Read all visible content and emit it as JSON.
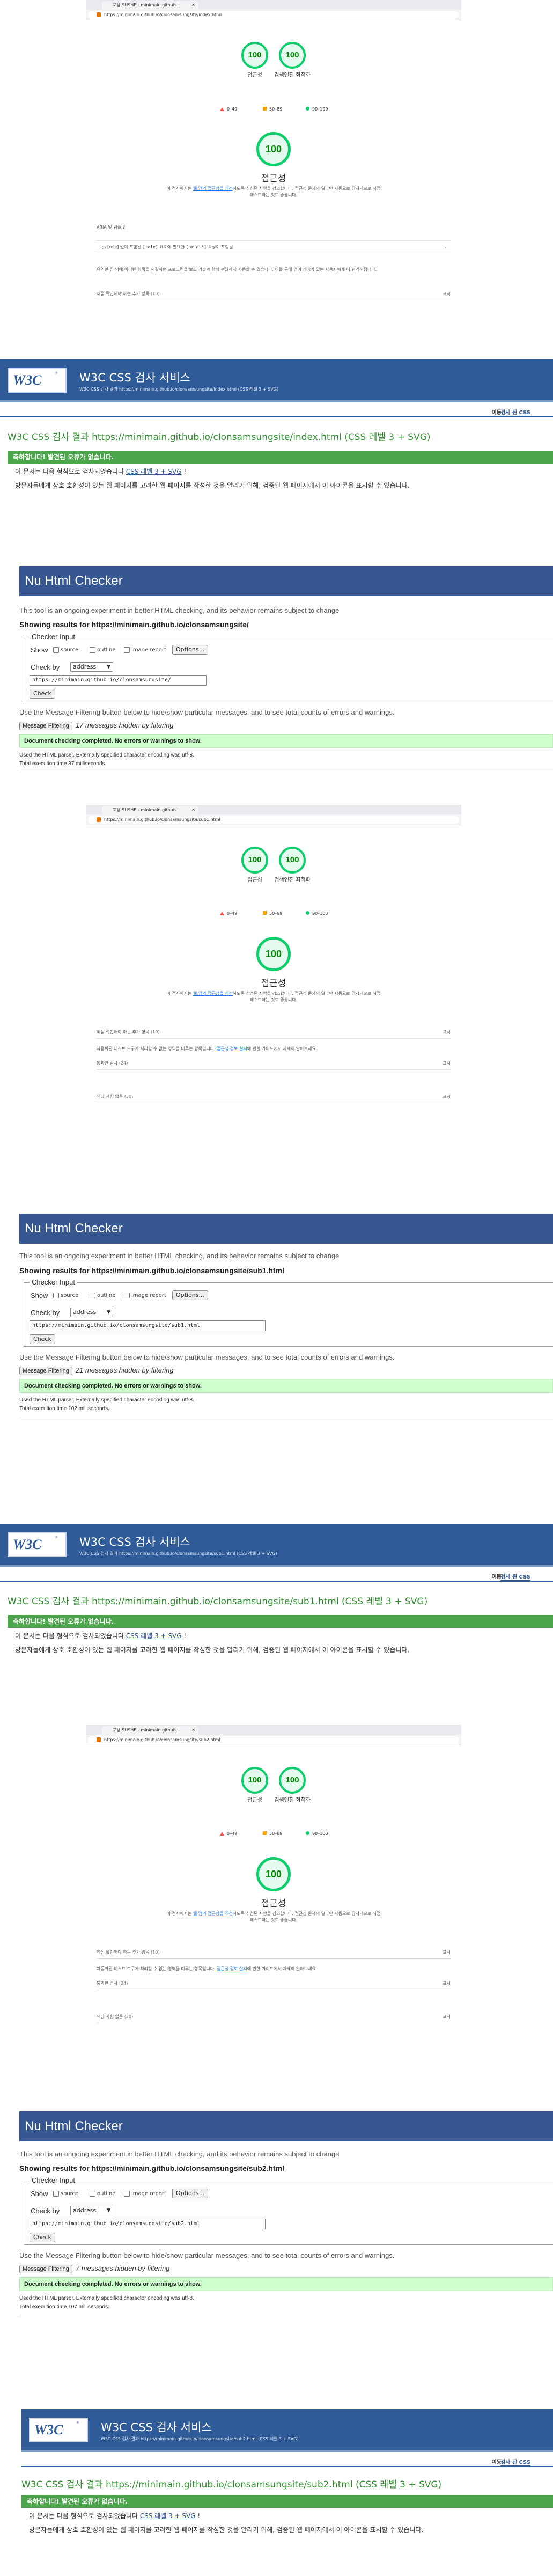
{
  "lh1": {
    "tab_title": "포용 SUSHE - minimain.github.i",
    "url": "https://minimain.github.io/clonsamsungsite/index.html",
    "gauges": [
      {
        "value": "100",
        "label": "접근성"
      },
      {
        "value": "100",
        "label": "검색엔진 최적화"
      }
    ],
    "legend": [
      "0–49",
      "50–89",
      "90–100"
    ],
    "big_value": "100",
    "big_title": "접근성",
    "desc_pre": "이 검사에서는 ",
    "desc_link": "웹 앱의 접근성을 개선",
    "desc_post": "하도록 추천된 사항을 강조합니다. 접근성 문제의 일부만 자동으로 감지되므로 직접 테스트하는 것도 좋습니다.",
    "section_label": "ARIA 및 템플릿",
    "aria_item_pre": "[role] 값이 포함된 ",
    "aria_item_code": "[role]",
    "aria_item_mid": " 요소에 필요한 ",
    "aria_item_code2": "[aria-*]",
    "aria_item_post": " 속성이 포함됨",
    "para": "유익한 팁 외에 이러한 항목을 해결하면 프로그램을 보조 기술과 함께 수월하게 사용할 수 있습니다. 이를 통해 앱이 장애가 있는 사용자에게 더 편리해집니다.",
    "row1_label": "직접 확인해야 하는 추가 항목",
    "row1_count": "(10)",
    "row1_right": "표시"
  },
  "w3_1": {
    "title": "W3C CSS 검사 서비스",
    "sub": "W3C CSS 검사 결과 https://minimain.github.io/clonsamsungsite/index.html (CSS 레벨 3 + SVG)",
    "bar_label": "이동:",
    "bar_link": "검사 된 CSS",
    "result": "W3C CSS 검사 결과 https://minimain.github.io/clonsamsungsite/index.html (CSS 레벨 3 + SVG)",
    "ok": "축하합니다! 발견된 오류가 없습니다.",
    "line1_pre": "이 문서는 다음 형식으로 검사되었습니다 ",
    "line1_link": "CSS 레벨 3 + SVG",
    "line1_post": " !",
    "line2": "방문자들에게 상호 호환성이 있는 웹 페이지를 고려한 웹 페이지를 작성한 것을 알리기 위해, 검증된 웹 페이지에서 이 아이콘을 표시할 수 있습니다."
  },
  "nu1": {
    "title": "Nu Html Checker",
    "experiment": "This tool is an ongoing experiment in better HTML checking, and its behavior remains subject to change",
    "showing": "Showing results for https://minimain.github.io/clonsamsungsite/",
    "input_legend": "Checker Input",
    "show_label": "Show",
    "cb_source": "source",
    "cb_outline": "outline",
    "cb_image": "image report",
    "options_btn": "Options...",
    "checkby_label": "Check by",
    "checkby_value": "address",
    "url_value": "https://minimain.github.io/clonsamsungsite/",
    "check_btn": "Check",
    "filter_hint": "Use the Message Filtering button below to hide/show particular messages, and to see total counts of errors and warnings.",
    "filter_btn": "Message Filtering",
    "hidden": "17 messages hidden by filtering",
    "completed": "Document checking completed. No errors or warnings to show.",
    "parser": "Used the HTML parser. Externally specified character encoding was utf-8.",
    "time": "Total execution time 87 milliseconds."
  },
  "lh2": {
    "tab_title": "포용 SUSHE - minimain.github.i",
    "url": "https://minimain.github.io/clonsamsungsite/sub1.html",
    "gauges": [
      {
        "value": "100",
        "label": "접근성"
      },
      {
        "value": "100",
        "label": "검색엔진 최적화"
      }
    ],
    "legend": [
      "0–49",
      "50–89",
      "90–100"
    ],
    "big_value": "100",
    "big_title": "접근성",
    "desc_pre": "이 검사에서는 ",
    "desc_link": "웹 앱의 접근성을 개선",
    "desc_post": "하도록 추천된 사항을 강조합니다. 접근성 문제의 일부만 자동으로 감지되므로 직접 테스트하는 것도 좋습니다.",
    "row1_label": "직접 확인해야 하는 추가 항목",
    "row1_count": "(10)",
    "row1_right": "표시",
    "note_pre": "자동화된 테스트 도구가 처리할 수 없는 영역을 다루는 항목입니다. ",
    "note_link": "접근성 검토 실시",
    "note_post": "에 관한 가이드에서 자세히 알아보세요.",
    "row2_label": "통과한 검사",
    "row2_count": "(24)",
    "row2_right": "표시",
    "row3_label": "해당 사항 없음",
    "row3_count": "(30)",
    "row3_right": "표시"
  },
  "nu2": {
    "title": "Nu Html Checker",
    "experiment": "This tool is an ongoing experiment in better HTML checking, and its behavior remains subject to change",
    "showing": "Showing results for https://minimain.github.io/clonsamsungsite/sub1.html",
    "input_legend": "Checker Input",
    "show_label": "Show",
    "cb_source": "source",
    "cb_outline": "outline",
    "cb_image": "image report",
    "options_btn": "Options...",
    "checkby_label": "Check by",
    "checkby_value": "address",
    "url_value": "https://minimain.github.io/clonsamsungsite/sub1.html",
    "check_btn": "Check",
    "filter_hint": "Use the Message Filtering button below to hide/show particular messages, and to see total counts of errors and warnings.",
    "filter_btn": "Message Filtering",
    "hidden": "21 messages hidden by filtering",
    "completed": "Document checking completed. No errors or warnings to show.",
    "parser": "Used the HTML parser. Externally specified character encoding was utf-8.",
    "time": "Total execution time 102 milliseconds."
  },
  "w3_2": {
    "title": "W3C CSS 검사 서비스",
    "sub": "W3C CSS 검사 결과 https://minimain.github.io/clonsamsungsite/sub1.html (CSS 레벨 3 + SVG)",
    "bar_label": "이동:",
    "bar_link": "검사 된 CSS",
    "result": "W3C CSS 검사 결과 https://minimain.github.io/clonsamsungsite/sub1.html (CSS 레벨 3 + SVG)",
    "ok": "축하합니다! 발견된 오류가 없습니다.",
    "line1_pre": "이 문서는 다음 형식으로 검사되었습니다 ",
    "line1_link": "CSS 레벨 3 + SVG",
    "line1_post": " !",
    "line2": "방문자들에게 상호 호환성이 있는 웹 페이지를 고려한 웹 페이지를 작성한 것을 알리기 위해, 검증된 웹 페이지에서 이 아이콘을 표시할 수 있습니다."
  },
  "lh3": {
    "tab_title": "포용 SUSHE - minimain.github.i",
    "url": "https://minimain.github.io/clonsamsungsite/sub2.html",
    "gauges": [
      {
        "value": "100",
        "label": "접근성"
      },
      {
        "value": "100",
        "label": "검색엔진 최적화"
      }
    ],
    "legend": [
      "0–49",
      "50–89",
      "90–100"
    ],
    "big_value": "100",
    "big_title": "접근성",
    "desc_pre": "이 검사에서는 ",
    "desc_link": "웹 앱의 접근성을 개선",
    "desc_post": "하도록 추천된 사항을 강조합니다. 접근성 문제의 일부만 자동으로 감지되므로 직접 테스트하는 것도 좋습니다.",
    "row1_label": "직접 확인해야 하는 추가 항목",
    "row1_count": "(10)",
    "row1_right": "표시",
    "note_pre": "자동화된 테스트 도구가 처리할 수 없는 영역을 다루는 항목입니다. ",
    "note_link": "접근성 검토 실시",
    "note_post": "에 관한 가이드에서 자세히 알아보세요.",
    "row2_label": "통과한 검사",
    "row2_count": "(24)",
    "row2_right": "표시",
    "row3_label": "해당 사항 없음",
    "row3_count": "(30)",
    "row3_right": "표시"
  },
  "nu3": {
    "title": "Nu Html Checker",
    "experiment": "This tool is an ongoing experiment in better HTML checking, and its behavior remains subject to change",
    "showing": "Showing results for https://minimain.github.io/clonsamsungsite/sub2.html",
    "input_legend": "Checker Input",
    "show_label": "Show",
    "cb_source": "source",
    "cb_outline": "outline",
    "cb_image": "image report",
    "options_btn": "Options...",
    "checkby_label": "Check by",
    "checkby_value": "address",
    "url_value": "https://minimain.github.io/clonsamsungsite/sub2.html",
    "check_btn": "Check",
    "filter_hint": "Use the Message Filtering button below to hide/show particular messages, and to see total counts of errors and warnings.",
    "filter_btn": "Message Filtering",
    "hidden": "7 messages hidden by filtering",
    "completed": "Document checking completed. No errors or warnings to show.",
    "parser": "Used the HTML parser. Externally specified character encoding was utf-8.",
    "time": "Total execution time 107 milliseconds."
  },
  "w3_3": {
    "title": "W3C CSS 검사 서비스",
    "sub": "W3C CSS 검사 결과 https://minimain.github.io/clonsamsungsite/sub2.html (CSS 레벨 3 + SVG)",
    "bar_label": "이동:",
    "bar_link": "검사 된 CSS",
    "result": "W3C CSS 검사 결과 https://minimain.github.io/clonsamsungsite/sub2.html (CSS 레벨 3 + SVG)",
    "ok": "축하합니다! 발견된 오류가 없습니다.",
    "line1_pre": "이 문서는 다음 형식으로 검사되었습니다 ",
    "line1_link": "CSS 레벨 3 + SVG",
    "line1_post": " !",
    "line2": "방문자들에게 상호 호환성이 있는 웹 페이지를 고려한 웹 페이지를 작성한 것을 알리기 위해, 검증된 웹 페이지에서 이 아이콘을 표시할 수 있습니다."
  }
}
